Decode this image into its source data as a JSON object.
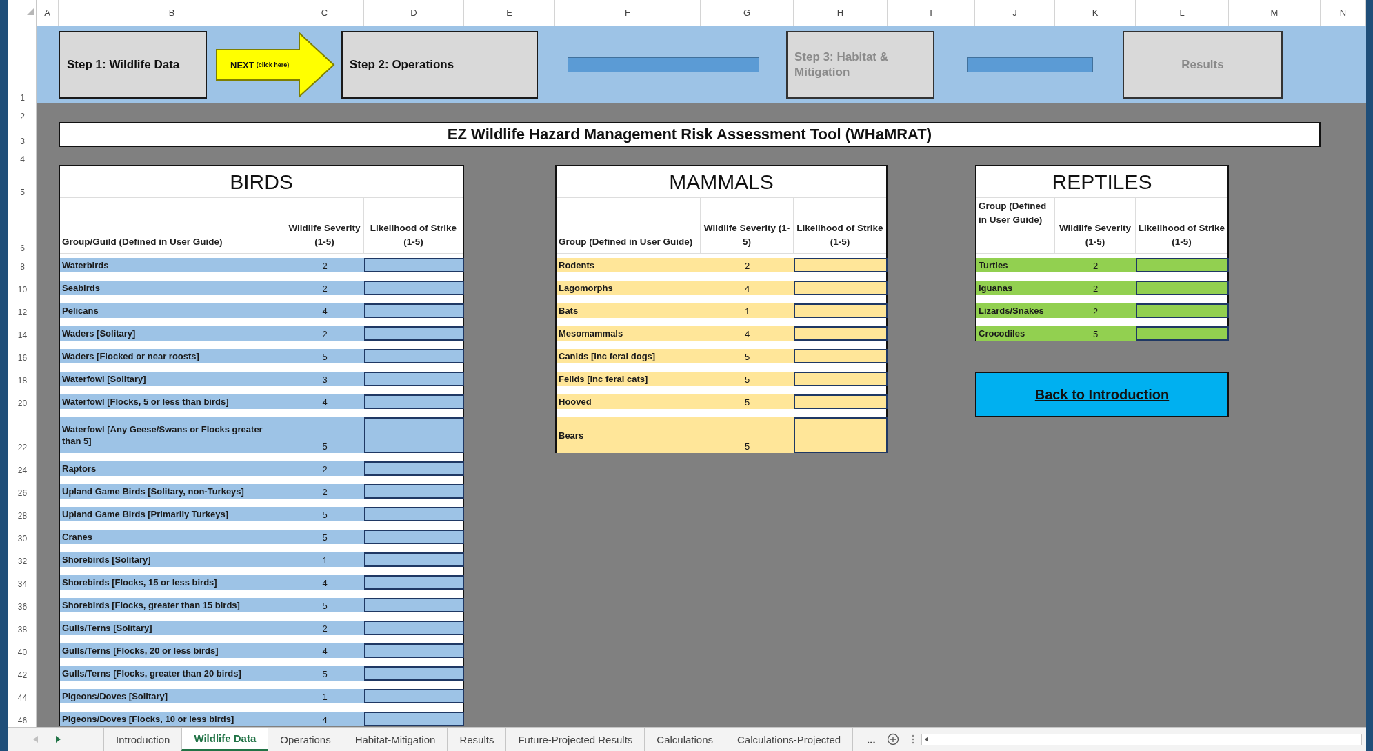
{
  "column_headers": [
    "A",
    "B",
    "C",
    "D",
    "E",
    "F",
    "G",
    "H",
    "I",
    "J",
    "K",
    "L",
    "M",
    "N"
  ],
  "row_headers": [
    "1",
    "2",
    "3",
    "4",
    "5",
    "6",
    "8",
    "10",
    "12",
    "14",
    "16",
    "18",
    "20",
    "22",
    "24",
    "26",
    "28",
    "30",
    "32",
    "34",
    "36",
    "38",
    "40",
    "42",
    "44",
    "46"
  ],
  "steps": [
    {
      "kind": "step",
      "label": "Step 1: Wildlife Data",
      "disabled": false
    },
    {
      "kind": "next",
      "label": "NEXT",
      "hint": "(click here)"
    },
    {
      "kind": "step",
      "label": "Step 2: Operations",
      "disabled": false
    },
    {
      "kind": "connector"
    },
    {
      "kind": "step",
      "label": "Step 3: Habitat & Mitigation",
      "disabled": true
    },
    {
      "kind": "connector"
    },
    {
      "kind": "step",
      "label": "Results",
      "disabled": true
    }
  ],
  "title": "EZ Wildlife Hazard Management Risk Assessment Tool (WHaMRAT)",
  "tables": [
    {
      "title": "BIRDS",
      "color": "#9dc3e6",
      "columns": [
        "Group/Guild (Defined in User Guide)",
        "Wildlife Severity (1-5)",
        "Likelihood of Strike (1-5)"
      ],
      "rows": [
        {
          "group": "Waterbirds",
          "severity": "2"
        },
        {
          "group": "Seabirds",
          "severity": "2"
        },
        {
          "group": "Pelicans",
          "severity": "4"
        },
        {
          "group": "Waders [Solitary]",
          "severity": "2"
        },
        {
          "group": "Waders [Flocked or near roosts]",
          "severity": "5"
        },
        {
          "group": "Waterfowl [Solitary]",
          "severity": "3"
        },
        {
          "group": "Waterfowl [Flocks, 5 or less than birds]",
          "severity": "4"
        },
        {
          "group": "Waterfowl [Any Geese/Swans or Flocks greater than 5]",
          "severity": "5"
        },
        {
          "group": "Raptors",
          "severity": "2"
        },
        {
          "group": "Upland Game Birds [Solitary, non-Turkeys]",
          "severity": "2"
        },
        {
          "group": "Upland Game Birds [Primarily Turkeys]",
          "severity": "5"
        },
        {
          "group": "Cranes",
          "severity": "5"
        },
        {
          "group": "Shorebirds [Solitary]",
          "severity": "1"
        },
        {
          "group": "Shorebirds [Flocks, 15 or less birds]",
          "severity": "4"
        },
        {
          "group": "Shorebirds [Flocks, greater than 15 birds]",
          "severity": "5"
        },
        {
          "group": "Gulls/Terns [Solitary]",
          "severity": "2"
        },
        {
          "group": "Gulls/Terns [Flocks, 20 or less birds]",
          "severity": "4"
        },
        {
          "group": "Gulls/Terns [Flocks, greater than 20 birds]",
          "severity": "5"
        },
        {
          "group": "Pigeons/Doves [Solitary]",
          "severity": "1"
        },
        {
          "group": "Pigeons/Doves [Flocks, 10 or less birds]",
          "severity": "4"
        }
      ]
    },
    {
      "title": "MAMMALS",
      "color": "#ffe699",
      "columns": [
        "Group (Defined in User Guide)",
        "Wildlife Severity (1-5)",
        "Likelihood of Strike (1-5)"
      ],
      "rows": [
        {
          "group": "Rodents",
          "severity": "2"
        },
        {
          "group": "Lagomorphs",
          "severity": "4"
        },
        {
          "group": "Bats",
          "severity": "1"
        },
        {
          "group": "Mesomammals",
          "severity": "4"
        },
        {
          "group": "Canids [inc feral dogs]",
          "severity": "5"
        },
        {
          "group": "Felids [inc feral cats]",
          "severity": "5"
        },
        {
          "group": "Hooved",
          "severity": "5"
        },
        {
          "group": "Bears",
          "severity": "5"
        }
      ]
    },
    {
      "title": "REPTILES",
      "color": "#92d050",
      "columns": [
        "Group (Defined in User Guide)",
        "Wildlife Severity (1-5)",
        "Likelihood of Strike (1-5)"
      ],
      "rows": [
        {
          "group": "Turtles",
          "severity": "2"
        },
        {
          "group": "Iguanas",
          "severity": "2"
        },
        {
          "group": "Lizards/Snakes",
          "severity": "2"
        },
        {
          "group": "Crocodiles",
          "severity": "5"
        }
      ]
    }
  ],
  "back_button": "Back to Introduction",
  "sheet_tabs": [
    {
      "label": "Introduction",
      "selected": false
    },
    {
      "label": "Wildlife Data",
      "selected": true
    },
    {
      "label": "Operations",
      "selected": false
    },
    {
      "label": "Habitat-Mitigation",
      "selected": false
    },
    {
      "label": "Results",
      "selected": false
    },
    {
      "label": "Future-Projected Results",
      "selected": false
    },
    {
      "label": "Calculations",
      "selected": false
    },
    {
      "label": "Calculations-Projected",
      "selected": false
    }
  ],
  "more_tabs": "..."
}
